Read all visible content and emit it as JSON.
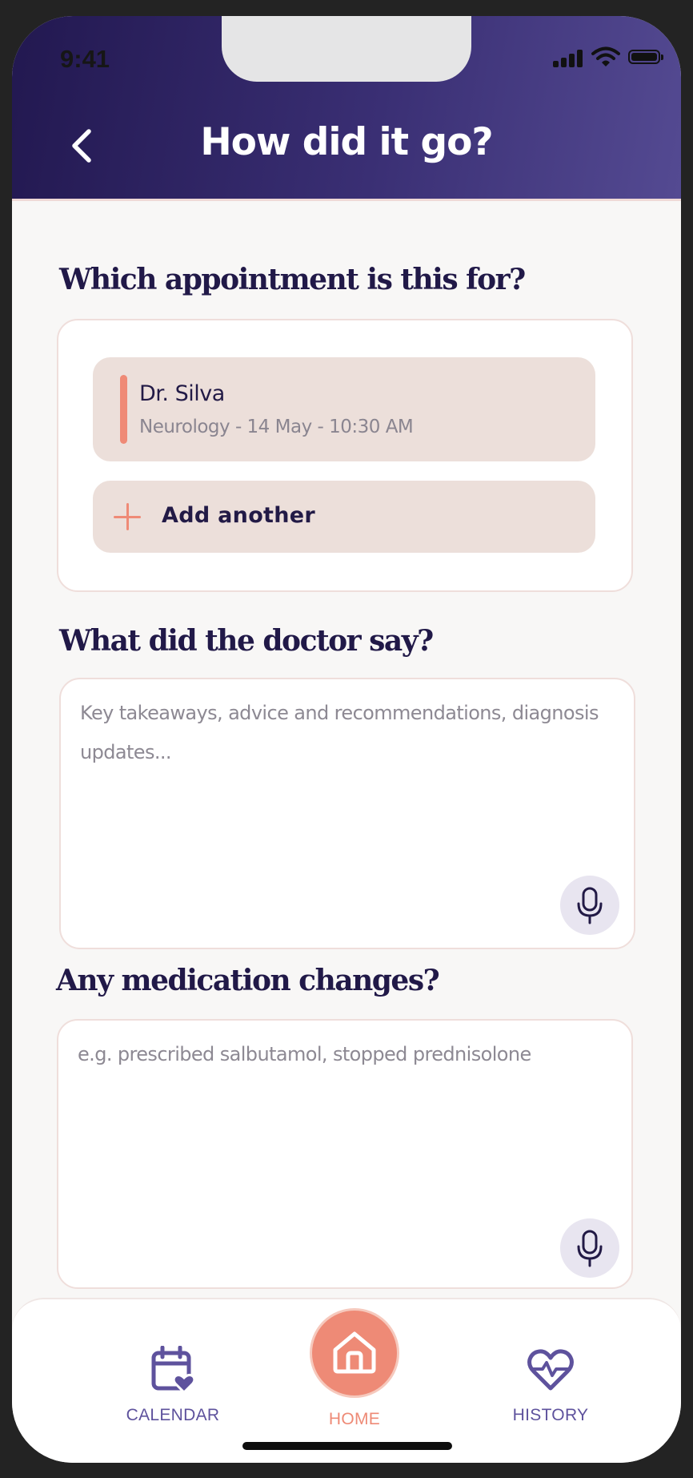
{
  "status_bar": {
    "time": "9:41",
    "icons": [
      "signal-icon",
      "wifi-icon",
      "battery-icon"
    ]
  },
  "header": {
    "back_icon": "chevron-left-icon",
    "title": "How did it go?"
  },
  "appointment_section": {
    "title": "Which appointment is this for?",
    "selected": {
      "name": "Dr. Silva",
      "details": "Neurology - 14 May - 10:30 AM"
    },
    "add_label": "Add another",
    "add_icon": "plus-icon"
  },
  "doctor_section": {
    "title": "What did the doctor say?",
    "placeholder": "Key takeaways, advice and recommendations, diagnosis updates...",
    "mic_icon": "microphone-icon"
  },
  "medication_section": {
    "title": "Any medication changes?",
    "placeholder": "e.g. prescribed salbutamol, stopped prednisolone",
    "mic_icon": "microphone-icon"
  },
  "bottom_nav": {
    "items": [
      {
        "label": "CALENDAR",
        "icon": "calendar-heart-icon"
      },
      {
        "label": "HOME",
        "icon": "home-icon",
        "active": true
      },
      {
        "label": "HISTORY",
        "icon": "heart-pulse-icon"
      }
    ]
  },
  "colors": {
    "header_gradient_start": "#221850",
    "header_gradient_end": "#544a92",
    "accent": "#ee8a76",
    "primary_text": "#211948",
    "nav_inactive": "#5e529d",
    "card_item_bg": "#ecdfda"
  }
}
